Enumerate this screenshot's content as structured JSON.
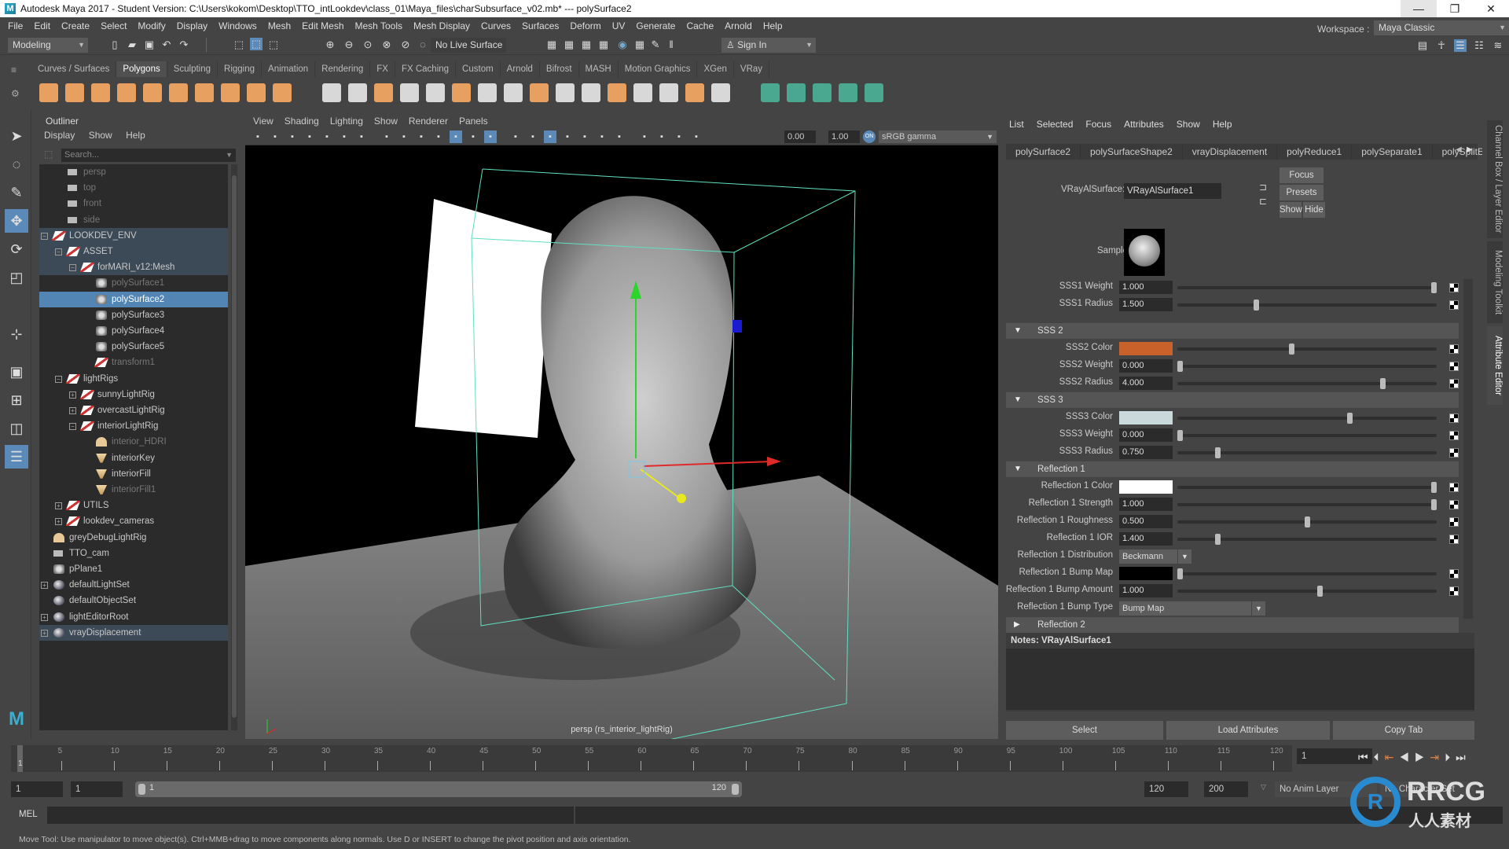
{
  "titlebar": {
    "title": "Autodesk Maya 2017 - Student Version: C:\\Users\\kokom\\Desktop\\TTO_intLookdev\\class_01\\Maya_files\\charSubsurface_v02.mb*  ---  polySurface2",
    "minimize": "—",
    "maximize": "❐",
    "close": "✕"
  },
  "menubar": [
    "File",
    "Edit",
    "Create",
    "Select",
    "Modify",
    "Display",
    "Windows",
    "Mesh",
    "Edit Mesh",
    "Mesh Tools",
    "Mesh Display",
    "Curves",
    "Surfaces",
    "Deform",
    "UV",
    "Generate",
    "Cache",
    "Arnold",
    "Help"
  ],
  "statusline": {
    "menuset": "Modeling",
    "live_surface": "No Live Surface",
    "sign_in": "Sign In",
    "workspace_label": "Workspace :",
    "workspace": "Maya Classic"
  },
  "shelf": {
    "tabs": [
      "Curves / Surfaces",
      "Polygons",
      "Sculpting",
      "Rigging",
      "Animation",
      "Rendering",
      "FX",
      "FX Caching",
      "Custom",
      "Arnold",
      "Bifrost",
      "MASH",
      "Motion Graphics",
      "XGen",
      "VRay"
    ],
    "active_tab": "Polygons"
  },
  "outliner": {
    "title": "Outliner",
    "menu": [
      "Display",
      "Show",
      "Help"
    ],
    "search_placeholder": "Search...",
    "items": [
      {
        "label": "persp",
        "type": "camera",
        "dim": true
      },
      {
        "label": "top",
        "type": "camera",
        "dim": true
      },
      {
        "label": "front",
        "type": "camera",
        "dim": true
      },
      {
        "label": "side",
        "type": "camera",
        "dim": true
      },
      {
        "label": "LOOKDEV_ENV",
        "type": "group",
        "expanded": true
      },
      {
        "label": "ASSET",
        "type": "group",
        "expanded": true
      },
      {
        "label": "forMARI_v12:Mesh",
        "type": "group",
        "expanded": true
      },
      {
        "label": "polySurface1",
        "type": "mesh",
        "dim": true
      },
      {
        "label": "polySurface2",
        "type": "mesh",
        "selected": true
      },
      {
        "label": "polySurface3",
        "type": "mesh"
      },
      {
        "label": "polySurface4",
        "type": "mesh"
      },
      {
        "label": "polySurface5",
        "type": "mesh"
      },
      {
        "label": "transform1",
        "type": "group",
        "dim": true
      },
      {
        "label": "lightRigs",
        "type": "group",
        "expanded": true
      },
      {
        "label": "sunnyLightRig",
        "type": "group",
        "expanded": false
      },
      {
        "label": "overcastLightRig",
        "type": "group",
        "expanded": false
      },
      {
        "label": "interiorLightRig",
        "type": "group",
        "expanded": true
      },
      {
        "label": "interior_HDRI",
        "type": "dome-light",
        "dim": true
      },
      {
        "label": "interiorKey",
        "type": "area-light"
      },
      {
        "label": "interiorFill",
        "type": "area-light"
      },
      {
        "label": "interiorFill1",
        "type": "area-light",
        "dim": true
      },
      {
        "label": "UTILS",
        "type": "group",
        "expanded": false
      },
      {
        "label": "lookdev_cameras",
        "type": "group",
        "expanded": false
      },
      {
        "label": "greyDebugLightRig",
        "type": "dome-light"
      },
      {
        "label": "TTO_cam",
        "type": "camera"
      },
      {
        "label": "pPlane1",
        "type": "mesh"
      },
      {
        "label": "defaultLightSet",
        "type": "set",
        "expanded": false
      },
      {
        "label": "defaultObjectSet",
        "type": "set"
      },
      {
        "label": "lightEditorRoot",
        "type": "set",
        "expanded": false
      },
      {
        "label": "vrayDisplacement",
        "type": "vray-set",
        "expanded": false,
        "highlight": true
      }
    ]
  },
  "viewport": {
    "menu": [
      "View",
      "Shading",
      "Lighting",
      "Show",
      "Renderer",
      "Panels"
    ],
    "exposure": "0.00",
    "gamma": "1.00",
    "color_space": "sRGB gamma",
    "camera_label": "persp (rs_interior_lightRig)"
  },
  "attribute_editor": {
    "menu": [
      "List",
      "Selected",
      "Focus",
      "Attributes",
      "Show",
      "Help"
    ],
    "tabs": [
      "polySurface2",
      "polySurfaceShape2",
      "vrayDisplacement",
      "polyReduce1",
      "polySeparate1",
      "polySplitEd"
    ],
    "node_type_label": "VRayAlSurface:",
    "node_name": "VRayAlSurface1",
    "buttons": {
      "focus": "Focus",
      "presets": "Presets",
      "show": "Show",
      "hide": "Hide"
    },
    "sample_label": "Sample",
    "attributes": [
      {
        "label": "SSS1 Weight",
        "value": "1.000",
        "slider": 1.0
      },
      {
        "label": "SSS1 Radius",
        "value": "1.500",
        "slider": 0.3
      },
      {
        "section": "SSS 2",
        "expanded": true
      },
      {
        "label": "SSS2 Color",
        "color": "#c8622a",
        "slider": 0.44
      },
      {
        "label": "SSS2 Weight",
        "value": "0.000",
        "slider": 0.0
      },
      {
        "label": "SSS2 Radius",
        "value": "4.000",
        "slider": 0.8
      },
      {
        "section": "SSS 3",
        "expanded": true
      },
      {
        "label": "SSS3 Color",
        "color": "#c9d9dc",
        "slider": 0.67
      },
      {
        "label": "SSS3 Weight",
        "value": "0.000",
        "slider": 0.0
      },
      {
        "label": "SSS3 Radius",
        "value": "0.750",
        "slider": 0.15
      },
      {
        "section": "Reflection 1",
        "expanded": true
      },
      {
        "label": "Reflection 1 Color",
        "color": "#ffffff",
        "slider": 1.0
      },
      {
        "label": "Reflection 1 Strength",
        "value": "1.000",
        "slider": 1.0
      },
      {
        "label": "Reflection 1 Roughness",
        "value": "0.500",
        "slider": 0.5
      },
      {
        "label": "Reflection 1 IOR",
        "value": "1.400",
        "slider": 0.15
      },
      {
        "label": "Reflection 1 Distribution",
        "combo": "Beckmann"
      },
      {
        "label": "Reflection 1 Bump Map",
        "color": "#000000",
        "slider": 0.0
      },
      {
        "label": "Reflection 1 Bump Amount",
        "value": "1.000",
        "slider": 0.55
      },
      {
        "label": "Reflection 1 Bump Type",
        "combo": "Bump Map"
      },
      {
        "section": "Reflection 2",
        "expanded": false
      }
    ],
    "notes_label": "Notes:  VRayAlSurface1",
    "bottom_buttons": [
      "Select",
      "Load Attributes",
      "Copy Tab"
    ]
  },
  "side_tabs": [
    "Channel Box / Layer Editor",
    "Modeling Toolkit",
    "Attribute Editor"
  ],
  "timeline": {
    "ticks": [
      5,
      10,
      15,
      20,
      25,
      30,
      35,
      40,
      45,
      50,
      55,
      60,
      65,
      70,
      75,
      80,
      85,
      90,
      95,
      100,
      105,
      110,
      115,
      120
    ],
    "current_frame_marker": "1",
    "current_frame": "1"
  },
  "range": {
    "start": "1",
    "anim_start": "1",
    "range_start_label": "1",
    "range_end_label": "120",
    "anim_end": "120",
    "end": "200",
    "anim_layer": "No Anim Layer",
    "character": "No Character Set"
  },
  "mel": {
    "label": "MEL"
  },
  "helpline": "Move Tool: Use manipulator to move object(s). Ctrl+MMB+drag to move components along normals. Use D or INSERT to change the pivot position and axis orientation.",
  "watermark": {
    "brand": "RRCG",
    "sub": "人人素材"
  }
}
